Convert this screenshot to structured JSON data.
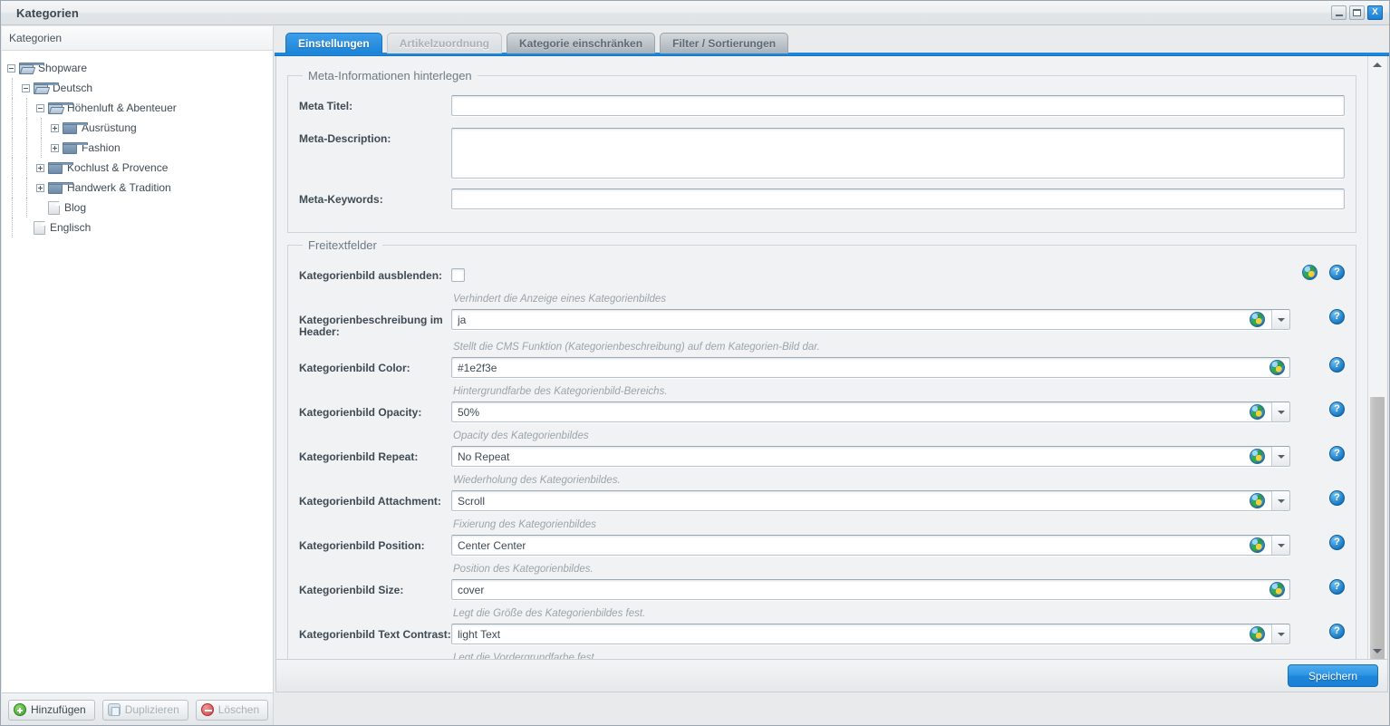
{
  "window": {
    "title": "Kategorien",
    "controls": {
      "minimize": "–",
      "maximize": "□",
      "close": "X"
    }
  },
  "tree": {
    "header": "Kategorien",
    "nodes": [
      {
        "label": "Shopware",
        "depth": 0,
        "icon": "folder-open-icon",
        "toggle": "minus"
      },
      {
        "label": "Deutsch",
        "depth": 1,
        "icon": "folder-open-icon",
        "toggle": "minus"
      },
      {
        "label": "Höhenluft & Abenteuer",
        "depth": 2,
        "icon": "folder-open-icon",
        "toggle": "minus"
      },
      {
        "label": "Ausrüstung",
        "depth": 3,
        "icon": "folder-icon",
        "toggle": "plus"
      },
      {
        "label": "Fashion",
        "depth": 3,
        "icon": "folder-icon",
        "toggle": "plus"
      },
      {
        "label": "Kochlust & Provence",
        "depth": 2,
        "icon": "folder-icon",
        "toggle": "plus"
      },
      {
        "label": "Handwerk & Tradition",
        "depth": 2,
        "icon": "folder-icon",
        "toggle": "plus"
      },
      {
        "label": "Blog",
        "depth": 2,
        "icon": "document-icon",
        "toggle": "none"
      },
      {
        "label": "Englisch",
        "depth": 1,
        "icon": "document-icon",
        "toggle": "none"
      }
    ]
  },
  "left_toolbar": {
    "add_label": "Hinzufügen",
    "duplicate_label": "Duplizieren",
    "delete_label": "Löschen"
  },
  "tabs": [
    {
      "label": "Einstellungen",
      "state": "active"
    },
    {
      "label": "Artikelzuordnung",
      "state": "disabled"
    },
    {
      "label": "Kategorie einschränken",
      "state": "normal"
    },
    {
      "label": "Filter / Sortierungen",
      "state": "normal"
    }
  ],
  "meta_section": {
    "legend": "Meta-Informationen hinterlegen",
    "fields": [
      {
        "label": "Meta Titel:",
        "value": "",
        "type": "text"
      },
      {
        "label": "Meta-Description:",
        "value": "",
        "type": "textarea"
      },
      {
        "label": "Meta-Keywords:",
        "value": "",
        "type": "text"
      }
    ]
  },
  "freetext_section": {
    "legend": "Freitextfelder",
    "rows": [
      {
        "label": "Kategorienbild ausblenden:",
        "type": "checkbox",
        "value": "",
        "checked": false,
        "help": "Verhindert die Anzeige eines Kategorienbildes",
        "has_dropdown": false,
        "globe_outside": true
      },
      {
        "label": "Kategorienbeschreibung im Header:",
        "type": "combo",
        "value": "ja",
        "help": "Stellt die CMS Funktion (Kategorienbeschreibung) auf dem Kategorien-Bild dar.",
        "has_dropdown": true,
        "globe_outside": false
      },
      {
        "label": "Kategorienbild Color:",
        "type": "text",
        "value": "#1e2f3e",
        "help": "Hintergrundfarbe des Kategorienbild-Bereichs.",
        "has_dropdown": false,
        "globe_outside": false
      },
      {
        "label": "Kategorienbild Opacity:",
        "type": "combo",
        "value": "50%",
        "help": "Opacity des Kategorienbildes",
        "has_dropdown": true,
        "globe_outside": false
      },
      {
        "label": "Kategorienbild Repeat:",
        "type": "combo",
        "value": "No Repeat",
        "help": "Wiederholung des Kategorienbildes.",
        "has_dropdown": true,
        "globe_outside": false
      },
      {
        "label": "Kategorienbild Attachment:",
        "type": "combo",
        "value": "Scroll",
        "help": "Fixierung des Kategorienbildes",
        "has_dropdown": true,
        "globe_outside": false
      },
      {
        "label": "Kategorienbild Position:",
        "type": "combo",
        "value": "Center Center",
        "help": "Position des Kategorienbildes.",
        "has_dropdown": true,
        "globe_outside": false
      },
      {
        "label": "Kategorienbild Size:",
        "type": "text",
        "value": "cover",
        "help": "Legt die Größe des Kategorienbildes fest.",
        "has_dropdown": false,
        "globe_outside": false
      },
      {
        "label": "Kategorienbild Text Contrast:",
        "type": "combo",
        "value": "light Text",
        "help": "Legt die Vordergrundfarbe fest.",
        "has_dropdown": true,
        "globe_outside": false
      }
    ]
  },
  "icons": {
    "globe": "globe-icon",
    "help": "?",
    "add": "plus-circle-icon",
    "duplicate": "copy-icon",
    "delete": "minus-circle-icon"
  },
  "footer": {
    "save_label": "Speichern"
  },
  "colors": {
    "accent": "#1e87da",
    "tab_active": "#2b93e3",
    "panel_bg": "#f1f2f3",
    "text": "#3e4a54",
    "help_text": "#9aa4ac"
  }
}
